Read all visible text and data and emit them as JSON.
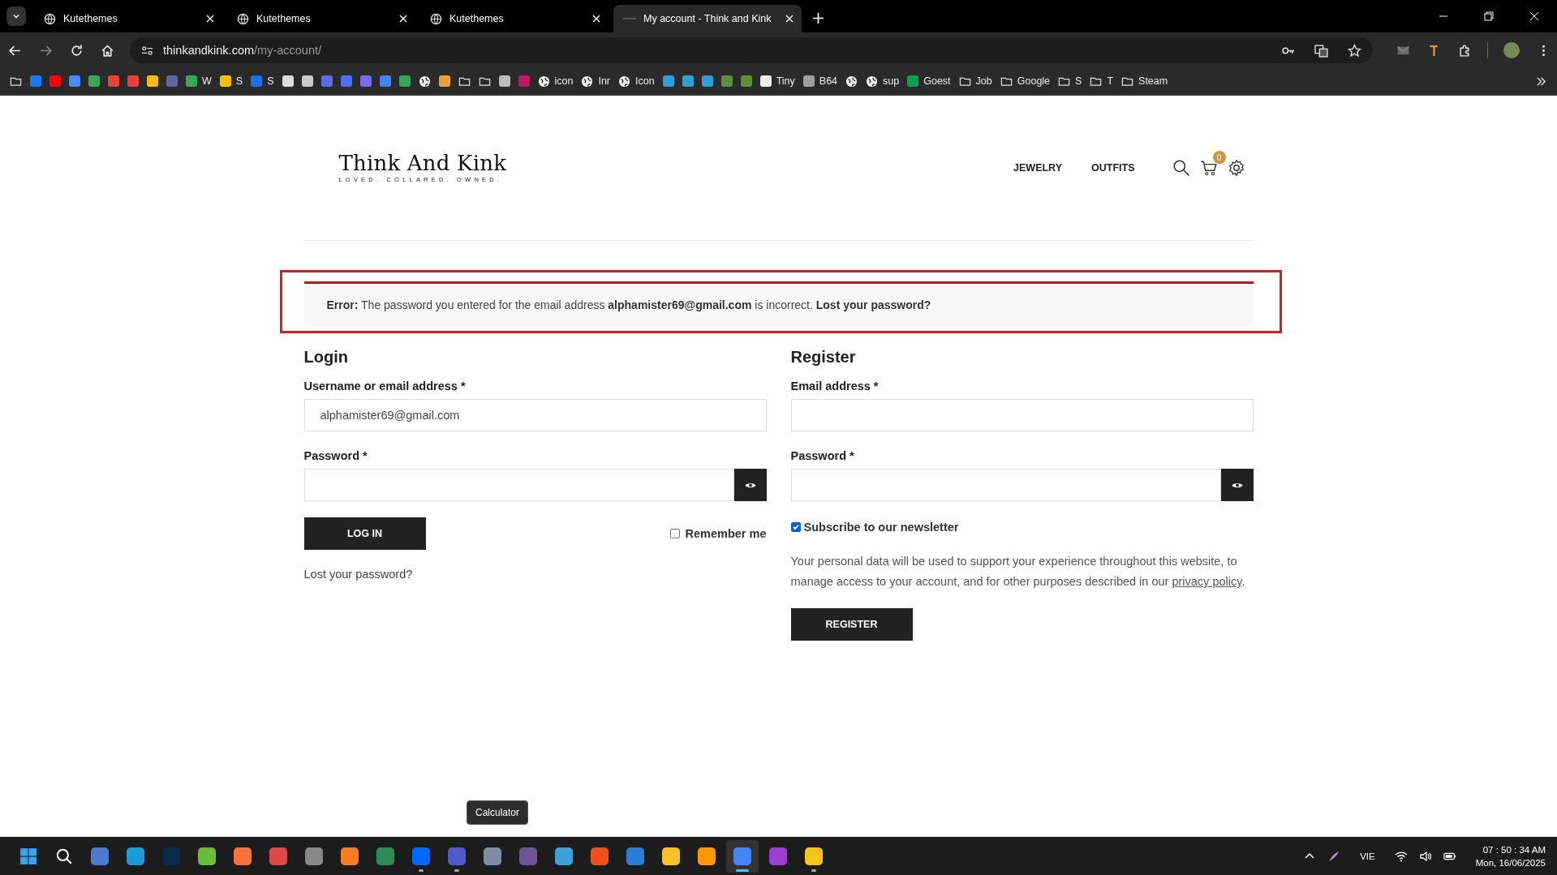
{
  "browser": {
    "tabs": [
      {
        "title": "Kutethemes",
        "selected": false
      },
      {
        "title": "Kutethemes",
        "selected": false
      },
      {
        "title": "Kutethemes",
        "selected": false
      },
      {
        "title": "My account - Think and Kink",
        "selected": true
      }
    ],
    "url_host": "thinkandkink.com",
    "url_path": "/my-account/",
    "bookmarks": [
      {
        "kind": "folder"
      },
      {
        "kind": "app",
        "color": "#1877f2"
      },
      {
        "kind": "app",
        "color": "#ff0000"
      },
      {
        "kind": "app",
        "color": "#4a8af4"
      },
      {
        "kind": "app",
        "color": "#34a853"
      },
      {
        "kind": "app",
        "color": "#ea4335"
      },
      {
        "kind": "app",
        "color": "#ea4335"
      },
      {
        "kind": "app",
        "color": "#fbbc04"
      },
      {
        "kind": "app",
        "color": "#6264a7"
      },
      {
        "kind": "app",
        "color": "#34a853",
        "label": "W"
      },
      {
        "kind": "app",
        "color": "#fbbc04",
        "label": "S"
      },
      {
        "kind": "app",
        "color": "#1a73e8",
        "label": "S"
      },
      {
        "kind": "app",
        "color": "#dddddd"
      },
      {
        "kind": "app",
        "color": "#cccccc"
      },
      {
        "kind": "app",
        "color": "#5b6ee1"
      },
      {
        "kind": "app",
        "color": "#4c6ef5"
      },
      {
        "kind": "app",
        "color": "#7b68ee"
      },
      {
        "kind": "app",
        "color": "#4285f4"
      },
      {
        "kind": "app",
        "color": "#34a853"
      },
      {
        "kind": "globe"
      },
      {
        "kind": "app",
        "color": "#e8a23b"
      },
      {
        "kind": "folder"
      },
      {
        "kind": "folder"
      },
      {
        "kind": "app",
        "color": "#bbbbbb"
      },
      {
        "kind": "app",
        "color": "#c2185b"
      },
      {
        "kind": "globe",
        "label": "icon"
      },
      {
        "kind": "globe",
        "label": "Inr"
      },
      {
        "kind": "globe",
        "label": "Icon"
      },
      {
        "kind": "app",
        "color": "#2f9fd8"
      },
      {
        "kind": "app",
        "color": "#2f9fd8"
      },
      {
        "kind": "app",
        "color": "#2f9fd8"
      },
      {
        "kind": "app",
        "color": "#5e8e3e"
      },
      {
        "kind": "app",
        "color": "#5e8e3e"
      },
      {
        "kind": "app",
        "color": "#eeeeee",
        "label": "Tiny"
      },
      {
        "kind": "app",
        "color": "#9e9e9e",
        "label": "B64"
      },
      {
        "kind": "globe"
      },
      {
        "kind": "globe",
        "label": "sup"
      },
      {
        "kind": "app",
        "color": "#0f9d58",
        "label": "Goest"
      },
      {
        "kind": "folder",
        "label": "Job"
      },
      {
        "kind": "folder",
        "label": "Google"
      },
      {
        "kind": "folder",
        "label": "S"
      },
      {
        "kind": "folder",
        "label": "T"
      },
      {
        "kind": "folder",
        "label": "Steam"
      }
    ]
  },
  "site": {
    "logo": "Think And Kink",
    "tagline": "LOVED. COLLARED. OWNED.",
    "nav": [
      "JEWELRY",
      "OUTFITS"
    ],
    "cart_count": "0"
  },
  "error": "**Error:** The password you entered for the email address **alphamister69@gmail.com** is incorrect. **Lost your password?**",
  "login": {
    "heading": "Login",
    "username_label": "Username or email address *",
    "username_value": "alphamister69@gmail.com",
    "password_label": "Password *",
    "button": "LOG IN",
    "remember_label": "Remember me",
    "remember_checked": false,
    "lost_password": "Lost your password?"
  },
  "register": {
    "heading": "Register",
    "email_label": "Email address *",
    "password_label": "Password *",
    "subscribe_label": "Subscribe to our newsletter",
    "subscribe_checked": true,
    "privacy_text": "Your personal data will be used to support your experience throughout this website, to manage access to your account, and for other purposes described in our",
    "privacy_link": "privacy policy",
    "privacy_end": ".",
    "button": "REGISTER"
  },
  "tooltip": "Calculator",
  "taskbar": {
    "items": [
      {
        "kind": "start",
        "selected": false,
        "running": false
      },
      {
        "kind": "search",
        "selected": false,
        "running": false
      },
      {
        "kind": "app",
        "color": "#4a7bd0",
        "selected": false,
        "running": false
      },
      {
        "kind": "app",
        "color": "#1e9bd7",
        "selected": false,
        "running": false
      },
      {
        "kind": "app",
        "color": "#0b2a4a",
        "selected": false,
        "running": false
      },
      {
        "kind": "app",
        "color": "#6dbb3a",
        "selected": false,
        "running": false
      },
      {
        "kind": "app",
        "color": "#ff7139",
        "selected": false,
        "running": false
      },
      {
        "kind": "app",
        "color": "#e04848",
        "selected": false,
        "running": false
      },
      {
        "kind": "app",
        "color": "#888888",
        "selected": false,
        "running": false
      },
      {
        "kind": "app",
        "color": "#fb7a24",
        "selected": false,
        "running": false
      },
      {
        "kind": "app",
        "color": "#2e8b57",
        "selected": false,
        "running": false
      },
      {
        "kind": "app",
        "color": "#0068ff",
        "selected": false,
        "running": true
      },
      {
        "kind": "app",
        "color": "#5059c9",
        "selected": false,
        "running": true
      },
      {
        "kind": "app",
        "color": "#7a8fa6",
        "selected": false,
        "running": false
      },
      {
        "kind": "app",
        "color": "#6e5494",
        "selected": false,
        "running": false
      },
      {
        "kind": "app",
        "color": "#3aa0d8",
        "selected": false,
        "running": false
      },
      {
        "kind": "app",
        "color": "#f24e1e",
        "selected": false,
        "running": false
      },
      {
        "kind": "app",
        "color": "#2b7cd3",
        "selected": false,
        "running": false
      },
      {
        "kind": "app",
        "color": "#f8c22c",
        "selected": false,
        "running": false
      },
      {
        "kind": "app",
        "color": "#ff9800",
        "selected": false,
        "running": false
      },
      {
        "kind": "app",
        "color": "#4285f4",
        "selected": true,
        "running": true
      },
      {
        "kind": "app",
        "color": "#9b3fd0",
        "selected": false,
        "running": false
      },
      {
        "kind": "app",
        "color": "#f5c518",
        "selected": false,
        "running": true
      }
    ],
    "language": "VIE",
    "time": "07 : 50 : 34 AM",
    "date": "Mon, 16/06/2025"
  }
}
